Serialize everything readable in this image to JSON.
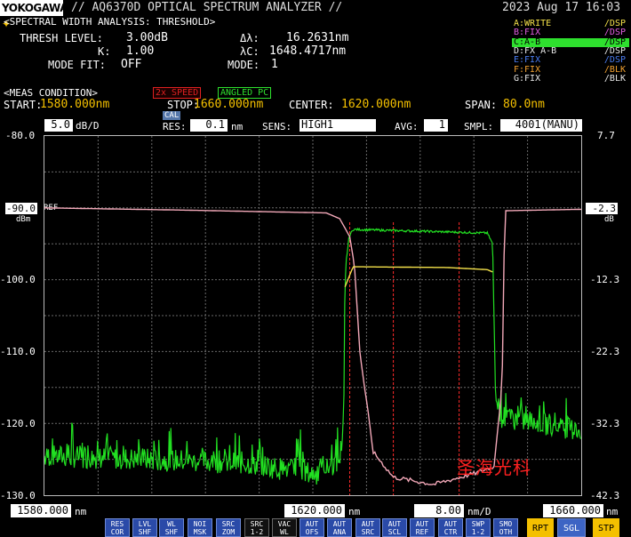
{
  "header": {
    "logo": "YOKOGAWA",
    "model": "// AQ6370D OPTICAL SPECTRUM ANALYZER //",
    "datetime": "2023 Aug 17 16:03"
  },
  "analysis": {
    "title": "<SPECTRAL WIDTH ANALYSIS: THRESHOLD>",
    "thresh_label": "THRESH LEVEL:",
    "thresh_value": "3.00dB",
    "k_label": "K:",
    "k_value": "1.00",
    "mode_fit_label": "MODE FIT:",
    "mode_fit_value": "OFF",
    "dl_label": "Δλ:",
    "dl_value": "16.2631nm",
    "lc_label": "λC:",
    "lc_value": "1648.4717nm",
    "mode_label": "MODE:",
    "mode_value": "1"
  },
  "traces": [
    {
      "name": "A:WRITE",
      "state": "/DSP",
      "color": "#f4e14a"
    },
    {
      "name": "B:FIX",
      "state": "/DSP",
      "color": "#e05ce0"
    },
    {
      "name": "C:A-B",
      "state": "/DSP",
      "color": "#000000"
    },
    {
      "name": "D:FX A-B",
      "state": "/DSP",
      "color": "#e8e8e8"
    },
    {
      "name": "E:FIX",
      "state": "/DSP",
      "color": "#4a7cf0"
    },
    {
      "name": "F:FIX",
      "state": "/BLK",
      "color": "#f0a030"
    },
    {
      "name": "G:FIX",
      "state": "/BLK",
      "color": "#e8e8e8"
    }
  ],
  "meas_condition": {
    "title": "<MEAS CONDITION>",
    "badge_speed": "2x SPEED",
    "badge_pc": "ANGLED PC",
    "start_label": "START:",
    "start_value": "1580.000nm",
    "stop_label": "STOP:",
    "stop_value": "1660.000nm",
    "center_label": "CENTER:",
    "center_value": "1620.000nm",
    "span_label": "SPAN:",
    "span_value": "80.0nm"
  },
  "settings": {
    "scale_value": "5.0",
    "scale_unit": "dB/D",
    "cal": "CAL",
    "res_label": "RES:",
    "res_value": "0.1",
    "res_unit": "nm",
    "sens_label": "SENS:",
    "sens_value": "HIGH1",
    "avg_label": "AVG:",
    "avg_value": "1",
    "smpl_label": "SMPL:",
    "smpl_value": "4001(MANU)"
  },
  "plot": {
    "left_ticks": [
      "-80.0",
      "",
      "-90.0",
      "-100.0",
      "-110.0",
      "-120.0",
      "-130.0"
    ],
    "ref_value": "-90.0",
    "ref_label": "REF",
    "left_unit": "dBm",
    "right_ticks": [
      "7.7",
      "-2.3",
      "-12.3",
      "-22.3",
      "-32.3",
      "-42.3"
    ],
    "right_unit": "dB",
    "watermark": "圣海光科"
  },
  "axis": {
    "start": "1580.000",
    "start_unit": "nm",
    "center": "1620.000",
    "center_unit": "nm",
    "scale": "8.00",
    "scale_unit": "nm/D",
    "stop": "1660.000",
    "stop_unit": "nm"
  },
  "softkeys": [
    {
      "l1": "RES",
      "l2": "COR"
    },
    {
      "l1": "LVL",
      "l2": "SHF"
    },
    {
      "l1": "WL",
      "l2": "SHF"
    },
    {
      "l1": "NOI",
      "l2": "MSK"
    },
    {
      "l1": "SRC",
      "l2": "ZOM"
    },
    {
      "l1": "SRC",
      "l2": "1-2"
    },
    {
      "l1": "VAC",
      "l2": "WL"
    },
    {
      "l1": "AUT",
      "l2": "OFS"
    },
    {
      "l1": "AUT",
      "l2": "ANA"
    },
    {
      "l1": "AUT",
      "l2": "SRC"
    },
    {
      "l1": "AUT",
      "l2": "SCL"
    },
    {
      "l1": "AUT",
      "l2": "REF"
    },
    {
      "l1": "AUT",
      "l2": "CTR"
    },
    {
      "l1": "SWP",
      "l2": "1-2"
    },
    {
      "l1": "SMO",
      "l2": "OTH"
    }
  ],
  "modes": {
    "rpt": "RPT",
    "sgl": "SGL",
    "stp": "STP"
  },
  "chart_data": {
    "type": "line",
    "x_unit": "nm",
    "xlim": [
      1580,
      1660
    ],
    "ylim": [
      -130,
      -80
    ],
    "right_ylim": [
      -42.3,
      7.7
    ],
    "series": [
      {
        "name": "A:WRITE",
        "color": "#f4e14a",
        "x": [
          1580,
          1610,
          1620,
          1621,
          1624,
          1624.6,
          1624.9,
          1625.4,
          1626,
          1646,
          1646.8,
          1647.2,
          1648,
          1660
        ],
        "y": [
          -124.5,
          -125.5,
          -127,
          -127,
          -125,
          -120,
          -98,
          -94,
          -93,
          -93.5,
          -95,
          -115,
          -119,
          -121
        ]
      },
      {
        "name": "B:FIX",
        "color": "#e05ce0",
        "x": [
          1580,
          1600,
          1622,
          1624,
          1625.5,
          1626.2,
          1627,
          1629,
          1632,
          1638,
          1644,
          1647,
          1648.2,
          1648.6,
          1660
        ],
        "y": [
          -90,
          -90.3,
          -90.7,
          -91.5,
          -94,
          -98,
          -110,
          -124,
          -127.5,
          -128.5,
          -127,
          -126,
          -115,
          -90.4,
          -90.2
        ]
      },
      {
        "name": "C:A-B",
        "color": "#000000",
        "x": [
          1624.8,
          1626,
          1640,
          1646,
          1647
        ],
        "y": [
          -101,
          -98.2,
          -98.3,
          -98.6,
          -99
        ]
      }
    ],
    "markers_x": [
      1625.5,
      1632.0,
      1641.8
    ]
  }
}
